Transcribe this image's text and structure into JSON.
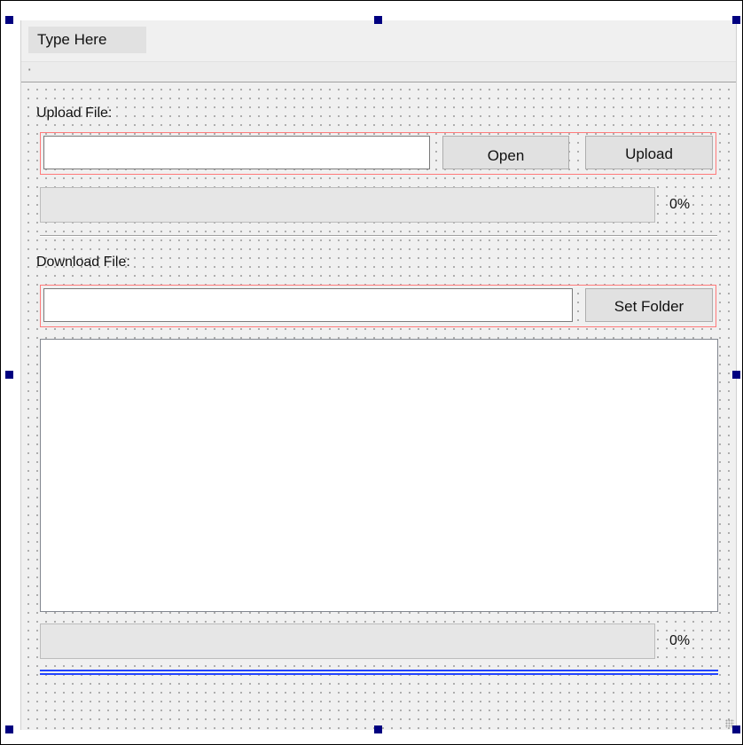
{
  "menubar": {
    "item_label": "Type Here"
  },
  "upload": {
    "title": "Upload File:",
    "path_value": "",
    "open_label": "Open",
    "upload_label": "Upload",
    "progress_value": 0,
    "progress_text": "0%"
  },
  "download": {
    "title": "Download File:",
    "folder_value": "",
    "set_folder_label": "Set Folder",
    "file_list": [],
    "progress_value": 0,
    "progress_text": "0%"
  },
  "colors": {
    "form_background": "#f0f0f0",
    "layout_outline": "#ff7a7a",
    "spacer_line": "#2244ff",
    "selection_handle": "#000080"
  },
  "icons": {
    "selection_handles": "handle-square-icon",
    "size_grip": "size-grip-icon"
  }
}
